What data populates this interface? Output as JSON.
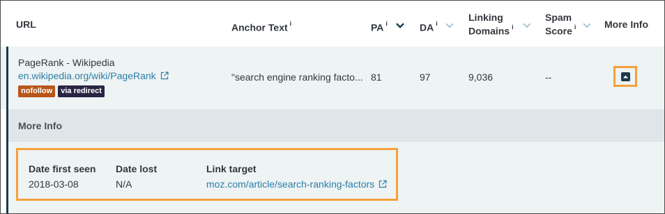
{
  "columns": {
    "url": "URL",
    "anchor": "Anchor Text",
    "pa": "PA",
    "da": "DA",
    "linking_line1": "Linking",
    "linking_line2": "Domains",
    "spam_line1": "Spam",
    "spam_line2": "Score",
    "more": "More Info",
    "info_mark": "i"
  },
  "row": {
    "title": "PageRank - Wikipedia",
    "url": "en.wikipedia.org/wiki/PageRank",
    "badges": [
      "nofollow",
      "via redirect"
    ],
    "anchor": "\"search engine ranking facto...",
    "pa": "81",
    "da": "97",
    "linking_domains": "9,036",
    "spam_score": "--"
  },
  "more_info": {
    "section_label": "More Info",
    "date_first_seen_label": "Date first seen",
    "date_first_seen": "2018-03-08",
    "date_lost_label": "Date lost",
    "date_lost": "N/A",
    "link_target_label": "Link target",
    "link_target": "moz.com/article/search-ranking-factors"
  },
  "colors": {
    "accent_link": "#2b7fa6",
    "highlight": "#f4a13a",
    "nofollow": "#b8561a",
    "redirect": "#2a2444"
  }
}
